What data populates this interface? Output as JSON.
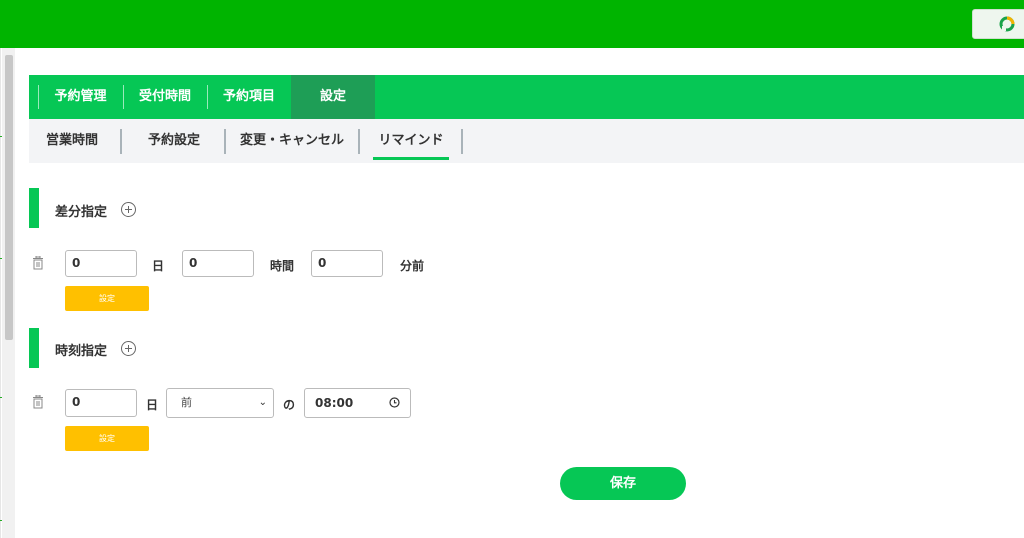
{
  "main_tabs": [
    "予約管理",
    "受付時間",
    "予約項目",
    "設定"
  ],
  "sub_tabs": [
    "営業時間",
    "予約設定",
    "変更・キャンセル",
    "リマインド"
  ],
  "relative": {
    "title": "差分指定",
    "days_value": "0",
    "days_label": "日",
    "hours_value": "0",
    "hours_label": "時間",
    "minutes_value": "0",
    "minutes_label": "分前",
    "set_label": "設定"
  },
  "absolute": {
    "title": "時刻指定",
    "days_value": "0",
    "days_label": "日",
    "select_value": "前",
    "connector": "の",
    "time_value": "08:00",
    "set_label": "設定"
  },
  "save_label": "保存",
  "colors": {
    "header_green": "#00b400",
    "tab_green": "#06c755",
    "active_tab": "#1e9e56",
    "set_button": "#ffc000"
  }
}
